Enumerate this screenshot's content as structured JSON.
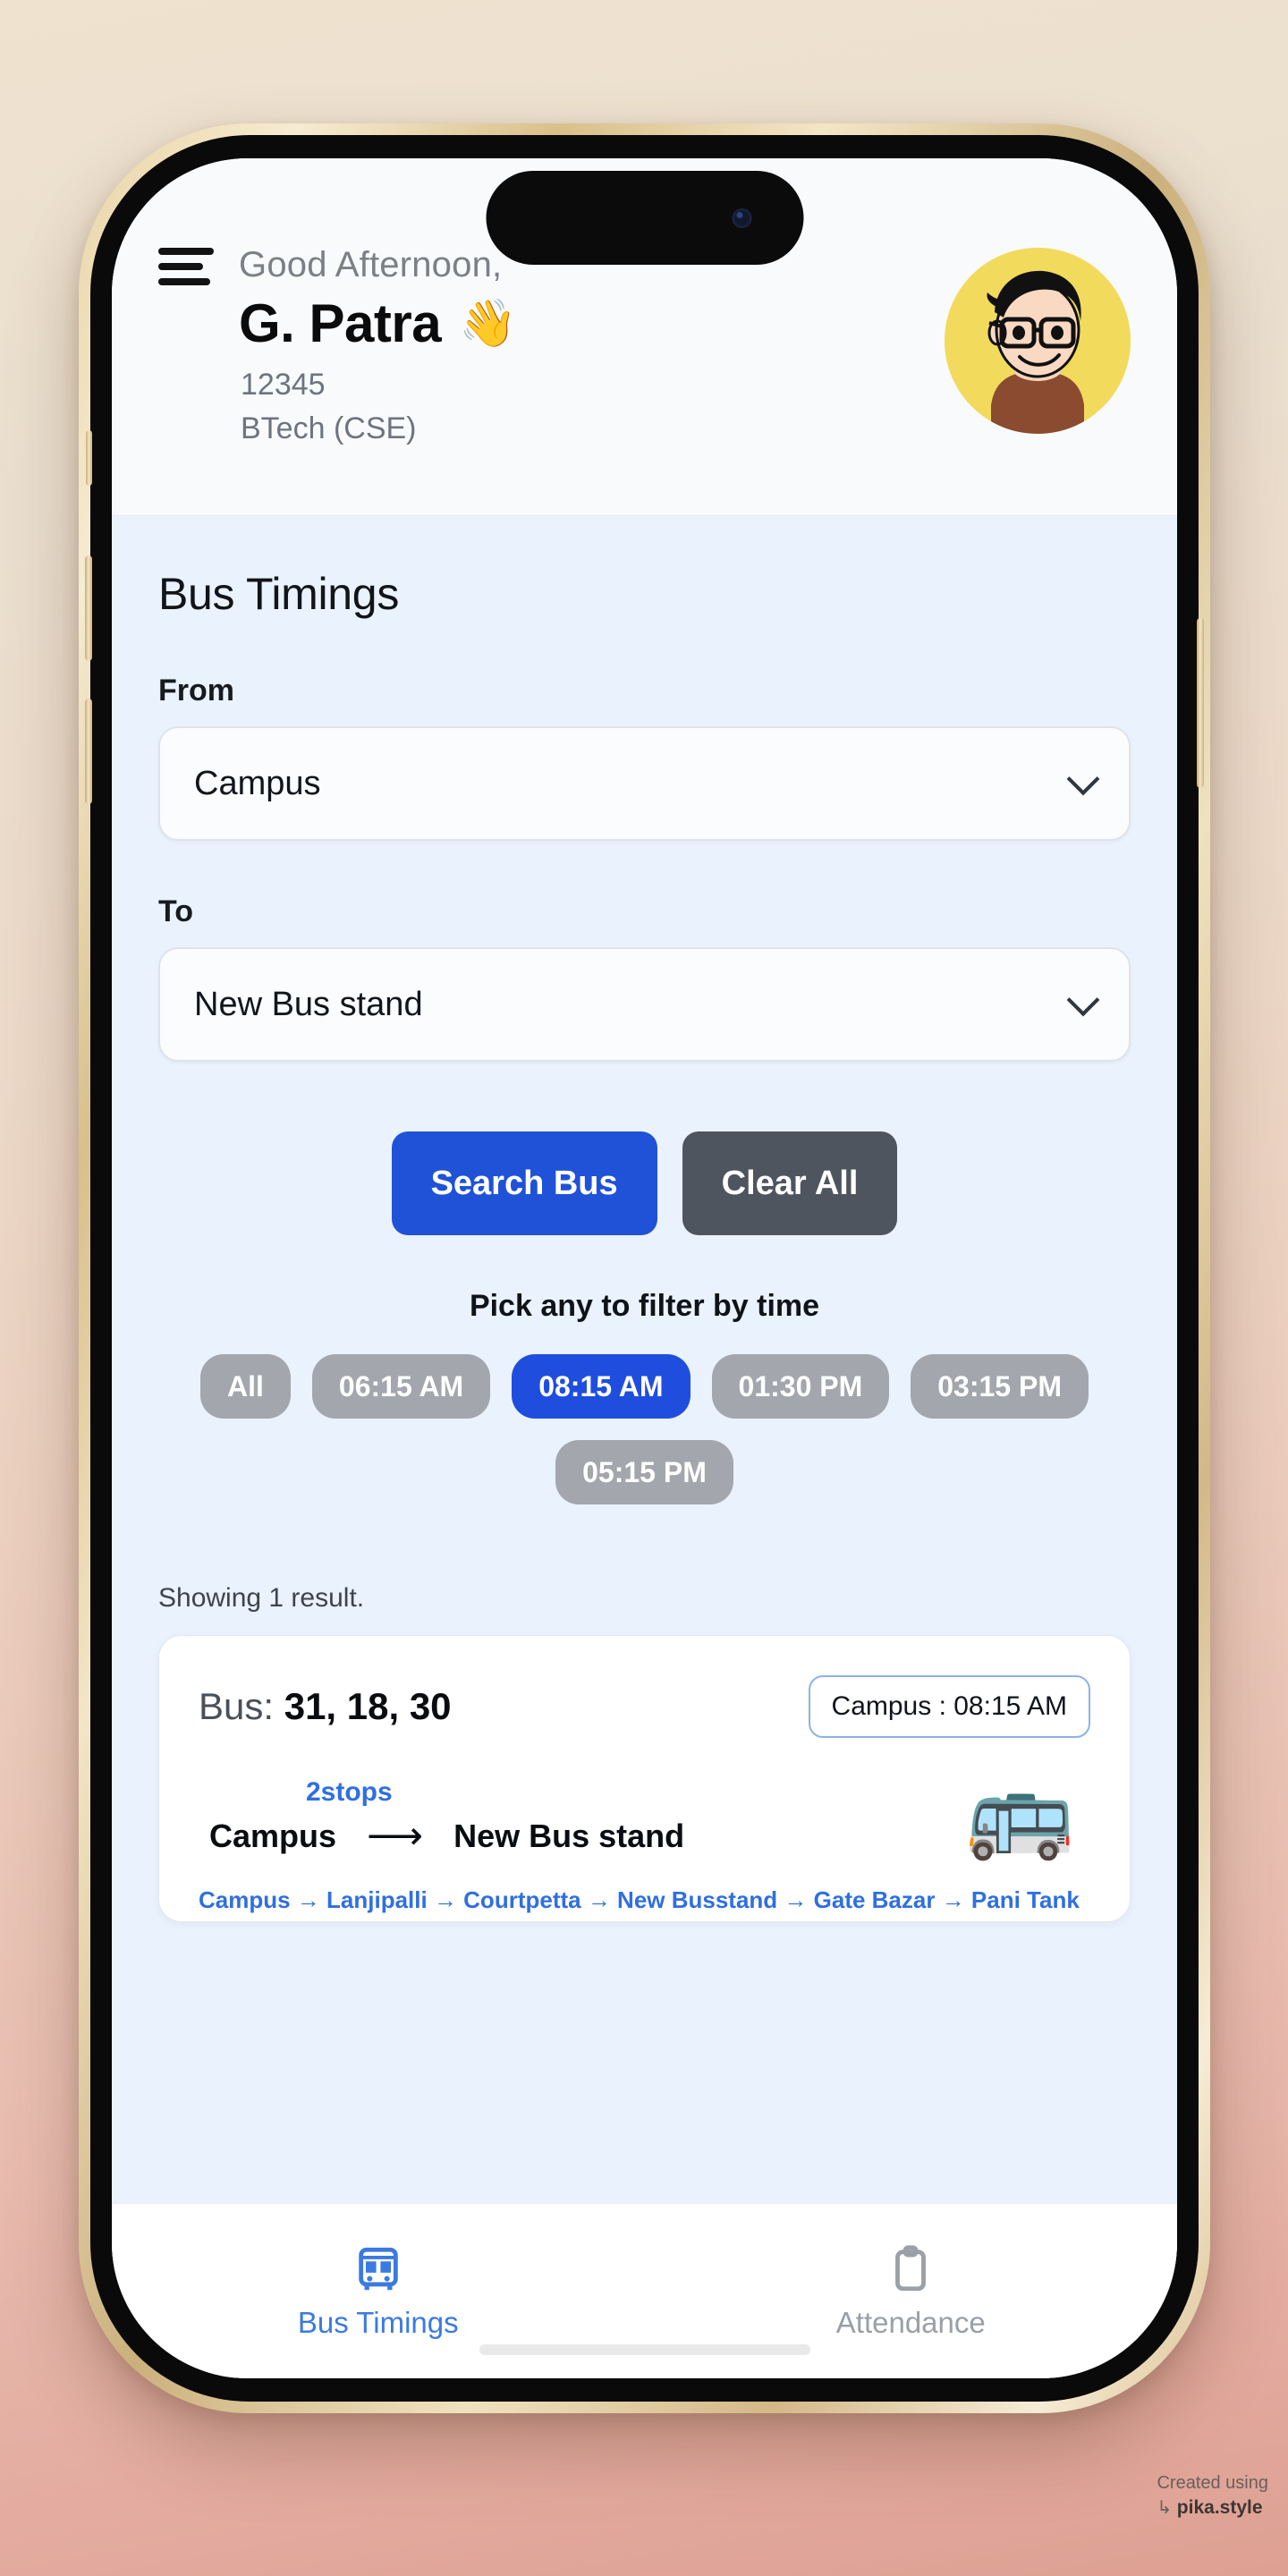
{
  "header": {
    "greeting": "Good Afternoon,",
    "user_name": "G. Patra",
    "wave_emoji": "👋",
    "user_id": "12345",
    "user_course": "BTech (CSE)",
    "menu_icon": "hamburger-menu-icon",
    "avatar_icon": "user-avatar"
  },
  "main": {
    "section_title": "Bus Timings",
    "from_label": "From",
    "from_value": "Campus",
    "to_label": "To",
    "to_value": "New Bus stand",
    "search_label": "Search Bus",
    "clear_label": "Clear All",
    "filter_title": "Pick any to filter by time",
    "filter_chips": [
      {
        "label": "All",
        "active": false
      },
      {
        "label": "06:15 AM",
        "active": false
      },
      {
        "label": "08:15 AM",
        "active": true
      },
      {
        "label": "01:30 PM",
        "active": false
      },
      {
        "label": "03:15 PM",
        "active": false
      },
      {
        "label": "05:15 PM",
        "active": false
      }
    ],
    "results_count": "Showing 1 result.",
    "result": {
      "bus_prefix": "Bus:",
      "bus_numbers": "31, 18, 30",
      "time_badge": "Campus : 08:15 AM",
      "stops_count": "2stops",
      "route_from": "Campus",
      "route_arrow": "⟶",
      "route_to": "New Bus stand",
      "bus_emoji": "🚌",
      "stops_chain": "Campus → Lanjipalli → Courtpetta → New Busstand → Gate Bazar → Pani Tank"
    }
  },
  "bottom_nav": [
    {
      "label": "Bus Timings",
      "icon": "bus-icon",
      "active": true
    },
    {
      "label": "Attendance",
      "icon": "clipboard-icon",
      "active": false
    }
  ],
  "watermark": {
    "line1": "Created using",
    "line2": "pika.style",
    "arrow": "↳"
  },
  "colors": {
    "accent_blue": "#2052d8",
    "chip_blue": "#1f4ede",
    "chip_gray": "#a3a7ad",
    "clear_gray": "#4e555f",
    "link_blue": "#2f6fe0",
    "body_bg": "#eaf2fd",
    "avatar_bg": "#f2da5c"
  }
}
